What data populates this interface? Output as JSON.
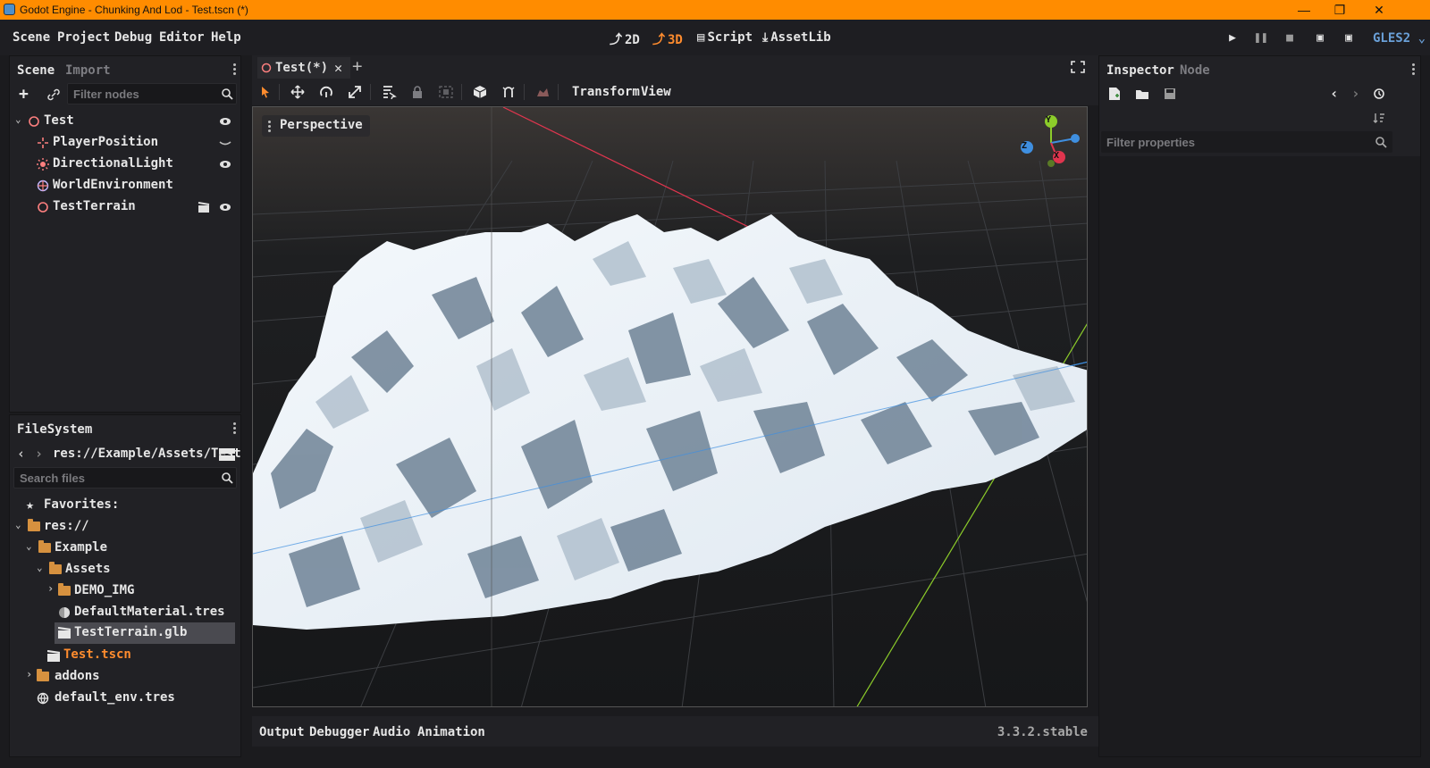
{
  "window": {
    "title": "Godot Engine - Chunking And Lod - Test.tscn (*)",
    "controls": [
      "—",
      "❐",
      "✕"
    ]
  },
  "menu": [
    "Scene",
    "Project",
    "Debug",
    "Editor",
    "Help"
  ],
  "workspaces": [
    {
      "label": "2D",
      "icon": "2d-icon",
      "active": false
    },
    {
      "label": "3D",
      "icon": "3d-icon",
      "active": true
    },
    {
      "label": "Script",
      "icon": "script-icon",
      "active": false
    },
    {
      "label": "AssetLib",
      "icon": "assetlib-icon",
      "active": false
    }
  ],
  "renderer": "GLES2",
  "scene_dock": {
    "tabs": [
      "Scene",
      "Import"
    ],
    "filter_placeholder": "Filter nodes",
    "nodes": [
      {
        "name": "Test",
        "icon": "spatial-icon",
        "visible_icon": "eye-icon"
      },
      {
        "name": "PlayerPosition",
        "icon": "position3d-icon",
        "visible_icon": "eye-closed-icon"
      },
      {
        "name": "DirectionalLight",
        "icon": "directional-light-icon",
        "visible_icon": "eye-icon"
      },
      {
        "name": "WorldEnvironment",
        "icon": "world-environment-icon",
        "visible_icon": ""
      },
      {
        "name": "TestTerrain",
        "icon": "spatial-icon",
        "visible_icon": "eye-icon",
        "extra_icon": "clapper-icon"
      }
    ]
  },
  "filesystem": {
    "title": "FileSystem",
    "path": "res://Example/Assets/Test",
    "search_placeholder": "Search files",
    "items": [
      {
        "label": "Favorites:",
        "icon": "star-icon"
      },
      {
        "label": "res://",
        "icon": "folder-icon"
      },
      {
        "label": "Example",
        "icon": "folder-icon"
      },
      {
        "label": "Assets",
        "icon": "folder-icon"
      },
      {
        "label": "DEMO_IMG",
        "icon": "folder-icon"
      },
      {
        "label": "DefaultMaterial.tres",
        "icon": "material-icon"
      },
      {
        "label": "TestTerrain.glb",
        "icon": "scene-icon",
        "selected": true
      },
      {
        "label": "Test.tscn",
        "icon": "scene-icon",
        "highlight": "#ff8c2e"
      },
      {
        "label": "addons",
        "icon": "folder-icon"
      },
      {
        "label": "default_env.tres",
        "icon": "environment-icon"
      }
    ]
  },
  "editor": {
    "tab_label": "Test(*)",
    "toolbar_menus": [
      "Transform",
      "View"
    ],
    "view_mode": "Perspective",
    "gizmo_axes": [
      "Y",
      "Z",
      "X"
    ]
  },
  "bottom_panel": {
    "tabs": [
      "Output",
      "Debugger",
      "Audio",
      "Animation"
    ],
    "version": "3.3.2.stable"
  },
  "inspector": {
    "tabs": [
      "Inspector",
      "Node"
    ],
    "filter_placeholder": "Filter properties"
  },
  "colors": {
    "accent": "#ff8c2e",
    "titlebar": "#ff8c00",
    "axis_x": "#e0354e",
    "axis_y": "#8ccc2a",
    "axis_z": "#3f8fe0"
  }
}
